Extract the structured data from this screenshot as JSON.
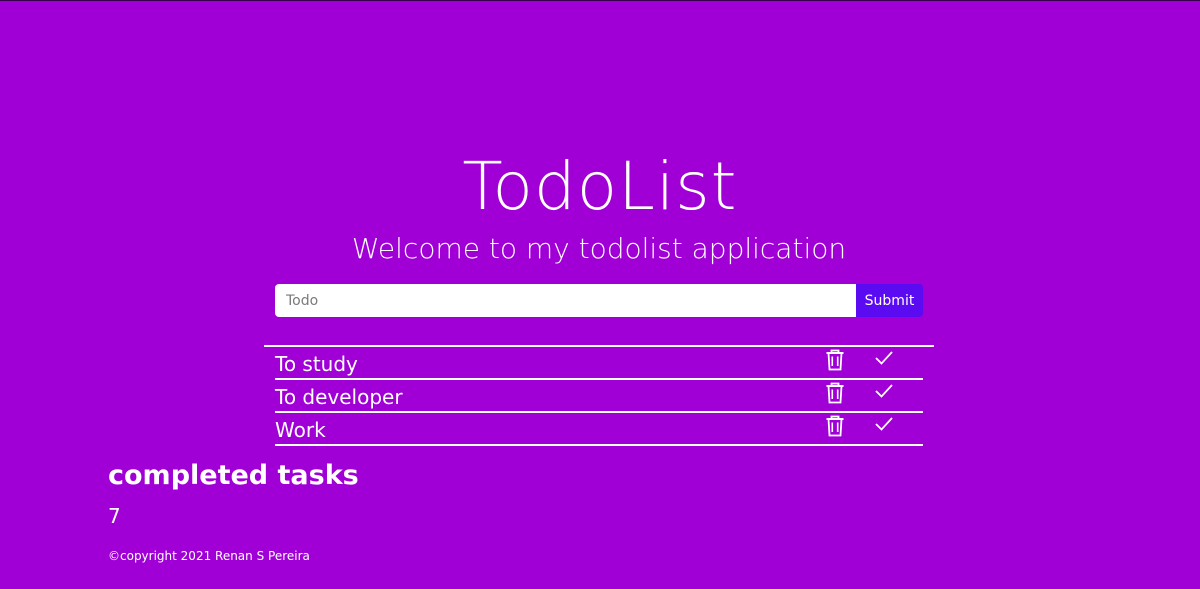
{
  "header": {
    "title": "TodoList",
    "subtitle": "Welcome to my todolist application"
  },
  "form": {
    "input_placeholder": "Todo",
    "input_value": "",
    "submit_label": "Submit"
  },
  "todos": [
    {
      "text": "To study",
      "delete_icon": "trash-icon",
      "complete_icon": "check-icon"
    },
    {
      "text": "To developer",
      "delete_icon": "trash-icon",
      "complete_icon": "check-icon"
    },
    {
      "text": "Work",
      "delete_icon": "trash-icon",
      "complete_icon": "check-icon"
    }
  ],
  "completed": {
    "heading": "completed tasks",
    "count": "7"
  },
  "footer": {
    "copyright": "©copyright 2021 Renan S Pereira"
  },
  "colors": {
    "background": "#a000d6",
    "submit_button": "#5a0bf2",
    "text": "#ffffff"
  }
}
